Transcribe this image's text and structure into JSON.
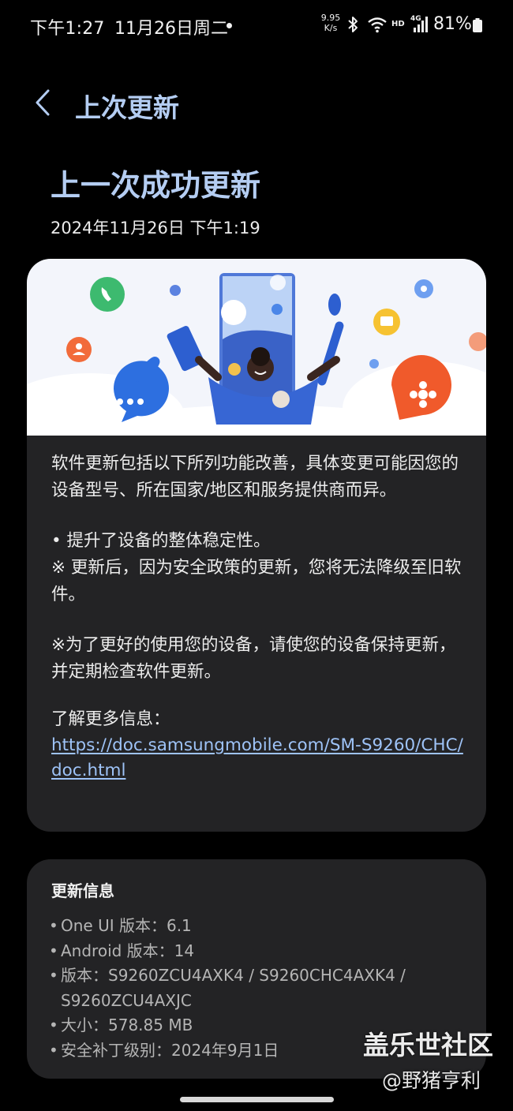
{
  "status_bar": {
    "time": "下午1:27",
    "date": "11月26日周二",
    "net_speed_value": "9.95",
    "net_speed_unit": "K/s",
    "hd": "HD",
    "network": "4G",
    "battery": "81%"
  },
  "header": {
    "title": "上次更新"
  },
  "summary": {
    "title": "上一次成功更新",
    "date": "2024年11月26日 下午1:19"
  },
  "details": {
    "intro": "软件更新包括以下所列功能改善，具体变更可能因您的设备型号、所在国家/地区和服务提供商而异。",
    "item_stability": "• 提升了设备的整体稳定性。",
    "note_downgrade": "※ 更新后，因为安全政策的更新，您将无法降级至旧软件。",
    "note_keep_updated": "※为了更好的使用您的设备，请使您的设备保持更新，并定期检查软件更新。",
    "more_info_label": "了解更多信息：",
    "more_info_link": "https://doc.samsungmobile.com/SM-S9260/CHC/doc.html"
  },
  "update_info": {
    "title": "更新信息",
    "items": [
      "One UI 版本：6.1",
      "Android 版本：14",
      "版本：S9260ZCU4AXK4 / S9260CHC4AXK4 / S9260ZCU4AXJC",
      "大小：578.85 MB",
      "安全补丁级别：2024年9月1日"
    ]
  },
  "watermark": {
    "forum": "盖乐世社区",
    "author": "@野猪亨利"
  },
  "colors": {
    "background": "#000000",
    "card": "#232325",
    "title_accent": "#b4cdf2",
    "link": "#9ec3f7"
  }
}
